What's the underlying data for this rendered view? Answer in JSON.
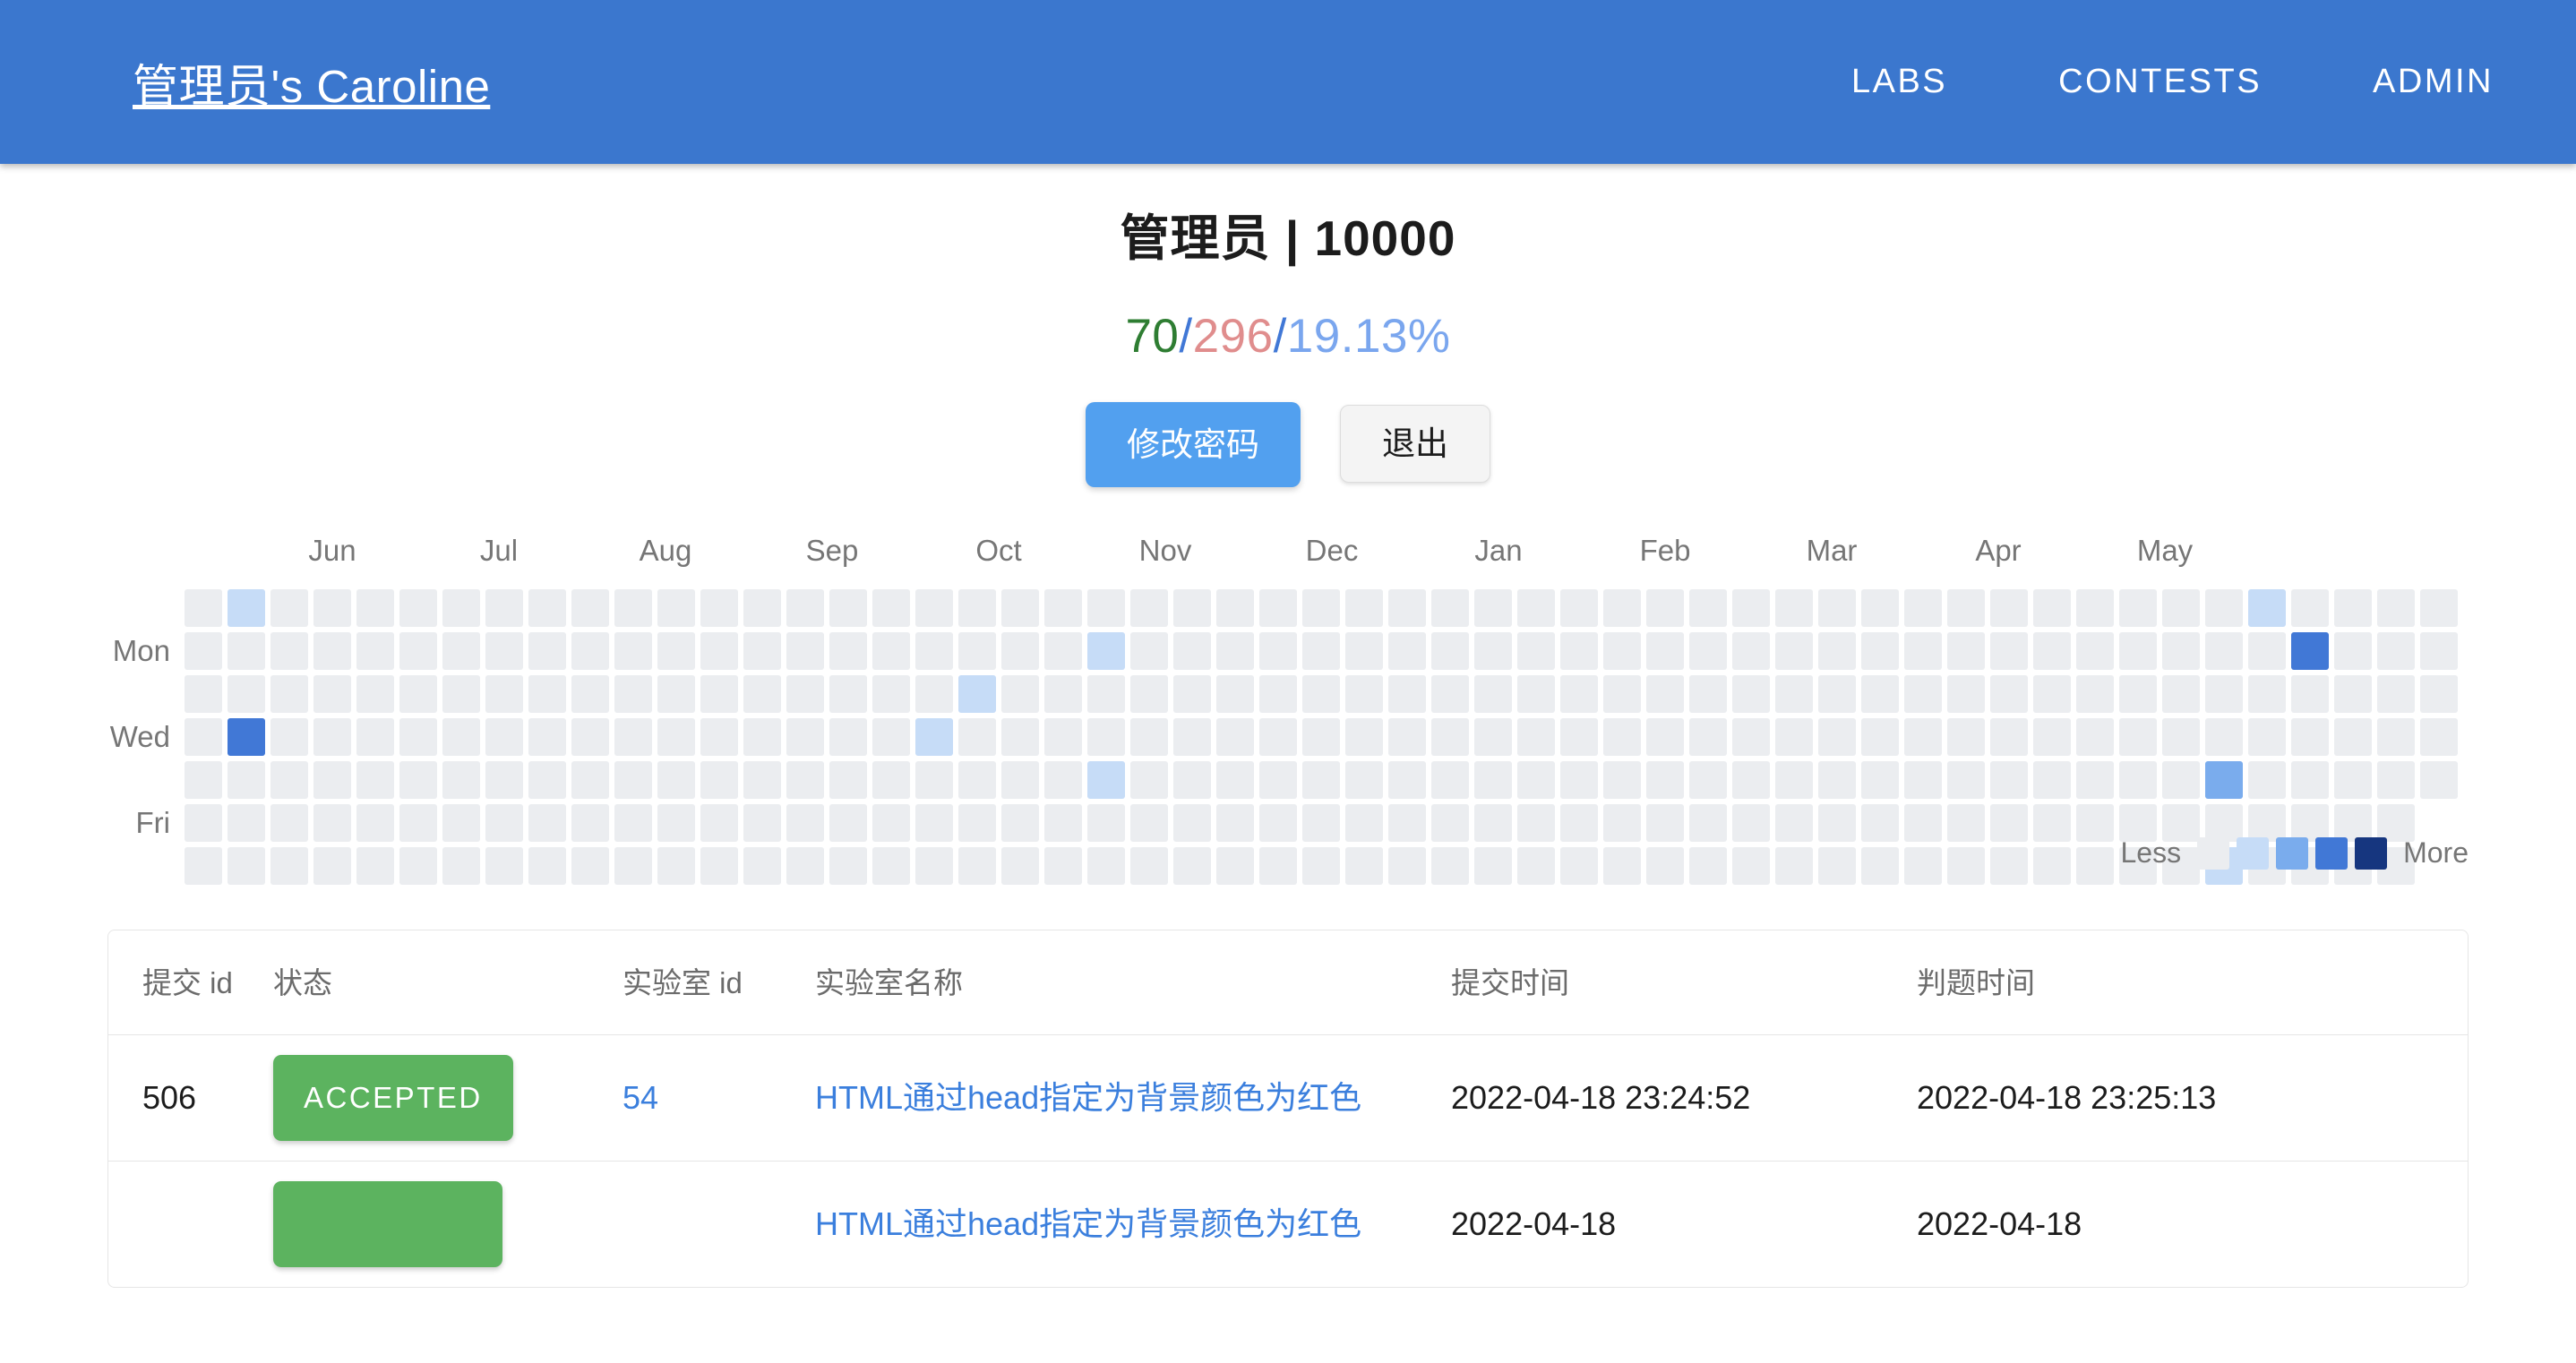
{
  "header": {
    "brand": "管理员's Caroline",
    "nav": [
      {
        "label": "LABS"
      },
      {
        "label": "CONTESTS"
      },
      {
        "label": "ADMIN"
      }
    ]
  },
  "profile": {
    "title": "管理员 | 10000",
    "accepted": "70",
    "separator1": "/",
    "total": "296",
    "separator2": "/",
    "rate": "19.13%",
    "change_password_label": "修改密码",
    "logout_label": "退出"
  },
  "heatmap": {
    "months": [
      "Jun",
      "Jul",
      "Aug",
      "Sep",
      "Oct",
      "Nov",
      "Dec",
      "Jan",
      "Feb",
      "Mar",
      "Apr",
      "May"
    ],
    "days": [
      "Mon",
      "Wed",
      "Fri"
    ],
    "legend_less": "Less",
    "legend_more": "More",
    "legend_colors": [
      "#ebedf0",
      "#c6dcf7",
      "#7aaced",
      "#4178d6",
      "#16367f"
    ],
    "empty_color": "#ebedf0",
    "cells": [
      {
        "col": 1,
        "row": 0,
        "level": 1
      },
      {
        "col": 1,
        "row": 3,
        "level": 3
      },
      {
        "col": 17,
        "row": 3,
        "level": 1
      },
      {
        "col": 18,
        "row": 2,
        "level": 1
      },
      {
        "col": 21,
        "row": 1,
        "level": 1
      },
      {
        "col": 21,
        "row": 4,
        "level": 1
      },
      {
        "col": 47,
        "row": 4,
        "level": 2
      },
      {
        "col": 47,
        "row": 6,
        "level": 1
      },
      {
        "col": 48,
        "row": 0,
        "level": 1
      },
      {
        "col": 49,
        "row": 1,
        "level": 3
      }
    ]
  },
  "table": {
    "columns": [
      "提交 id",
      "状态",
      "实验室 id",
      "实验室名称",
      "提交时间",
      "判题时间"
    ],
    "rows": [
      {
        "submission_id": "506",
        "status": "ACCEPTED",
        "lab_id": "54",
        "lab_name": "HTML通过head指定为背景颜色为红色",
        "submit_time": "2022-04-18 23:24:52",
        "judge_time": "2022-04-18 23:25:13"
      },
      {
        "submission_id": "",
        "status": "",
        "lab_id": "",
        "lab_name": "HTML通过head指定为背景颜色为红色",
        "submit_time": "2022-04-18",
        "judge_time": "2022-04-18"
      }
    ]
  }
}
